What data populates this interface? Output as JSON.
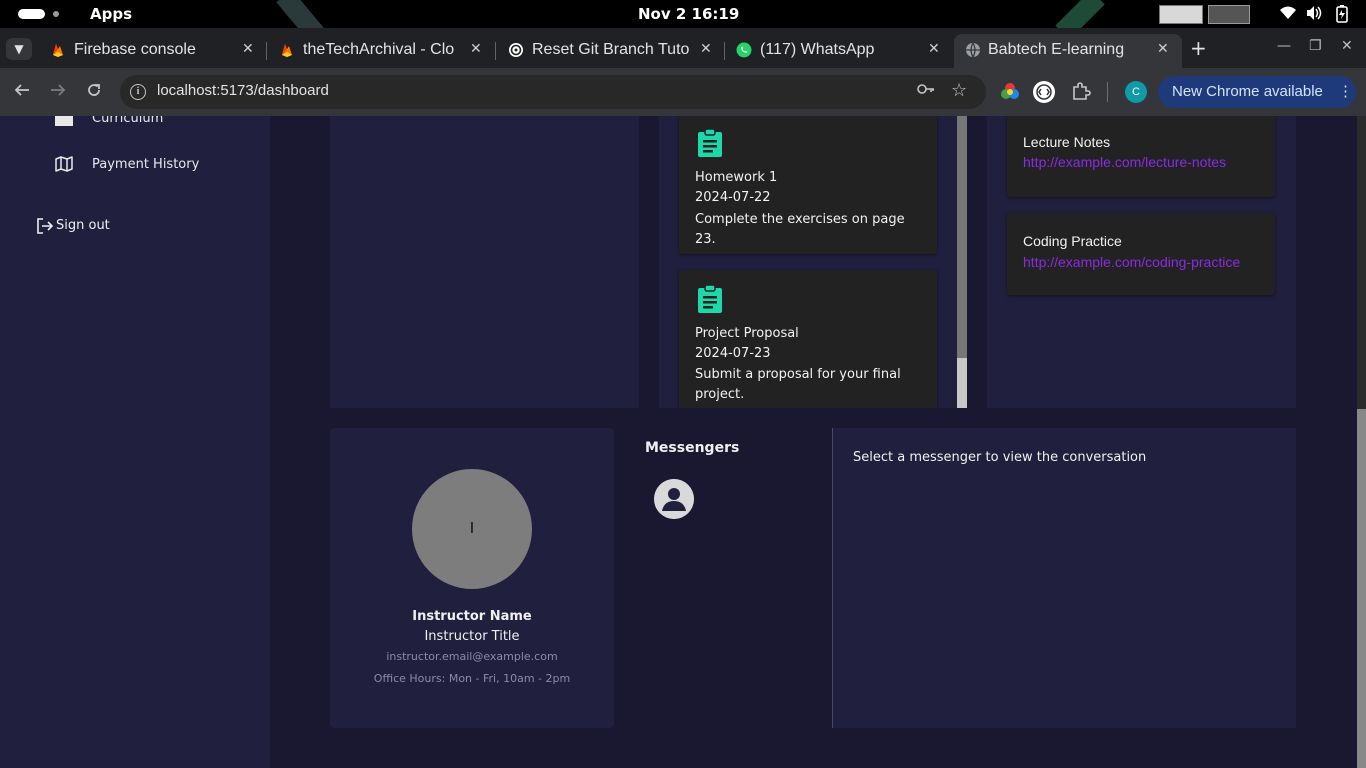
{
  "system_bar": {
    "apps_label": "Apps",
    "clock": "Nov 2  16:19"
  },
  "browser": {
    "tabs": [
      {
        "title": "Firebase console",
        "favicon": "firebase-icon"
      },
      {
        "title": "theTechArchival - Clo",
        "favicon": "firebase-icon"
      },
      {
        "title": "Reset Git Branch Tuto",
        "favicon": "openai-icon"
      },
      {
        "title": "(117) WhatsApp",
        "favicon": "whatsapp-icon"
      },
      {
        "title": "Babtech E-learning",
        "favicon": "globe-icon",
        "active": true
      }
    ],
    "url": "localhost:5173/dashboard",
    "profile_initial": "C",
    "update_button": "New Chrome available"
  },
  "sidebar": {
    "items": [
      {
        "label": "Curriculum",
        "icon": "book-icon"
      },
      {
        "label": "Payment History",
        "icon": "map-icon"
      }
    ],
    "sign_out": "Sign out"
  },
  "assignments": [
    {
      "title": "Homework 1",
      "date": "2024-07-22",
      "description": "Complete the exercises on page 23.",
      "icon": "clipboard-icon"
    },
    {
      "title": "Project Proposal",
      "date": "2024-07-23",
      "description": "Submit a proposal for your final project.",
      "icon": "clipboard-icon"
    }
  ],
  "resources": [
    {
      "name": "Lecture Notes",
      "url": "http://example.com/lecture-notes"
    },
    {
      "name": "Coding Practice",
      "url": "http://example.com/coding-practice"
    }
  ],
  "instructor": {
    "initial": "I",
    "name": "Instructor Name",
    "title": "Instructor Title",
    "email": "instructor.email@example.com",
    "office_hours": "Office Hours: Mon - Fri, 10am - 2pm"
  },
  "messengers": {
    "heading": "Messengers",
    "placeholder": "Select a messenger to view the conversation"
  },
  "colors": {
    "page_bg": "#1a1730",
    "panel_bg": "#211f3e",
    "card_bg": "#222222",
    "accent_icon": "#1dd8a8",
    "link": "#8a2be2",
    "update_button_bg": "#1e3a7a"
  }
}
